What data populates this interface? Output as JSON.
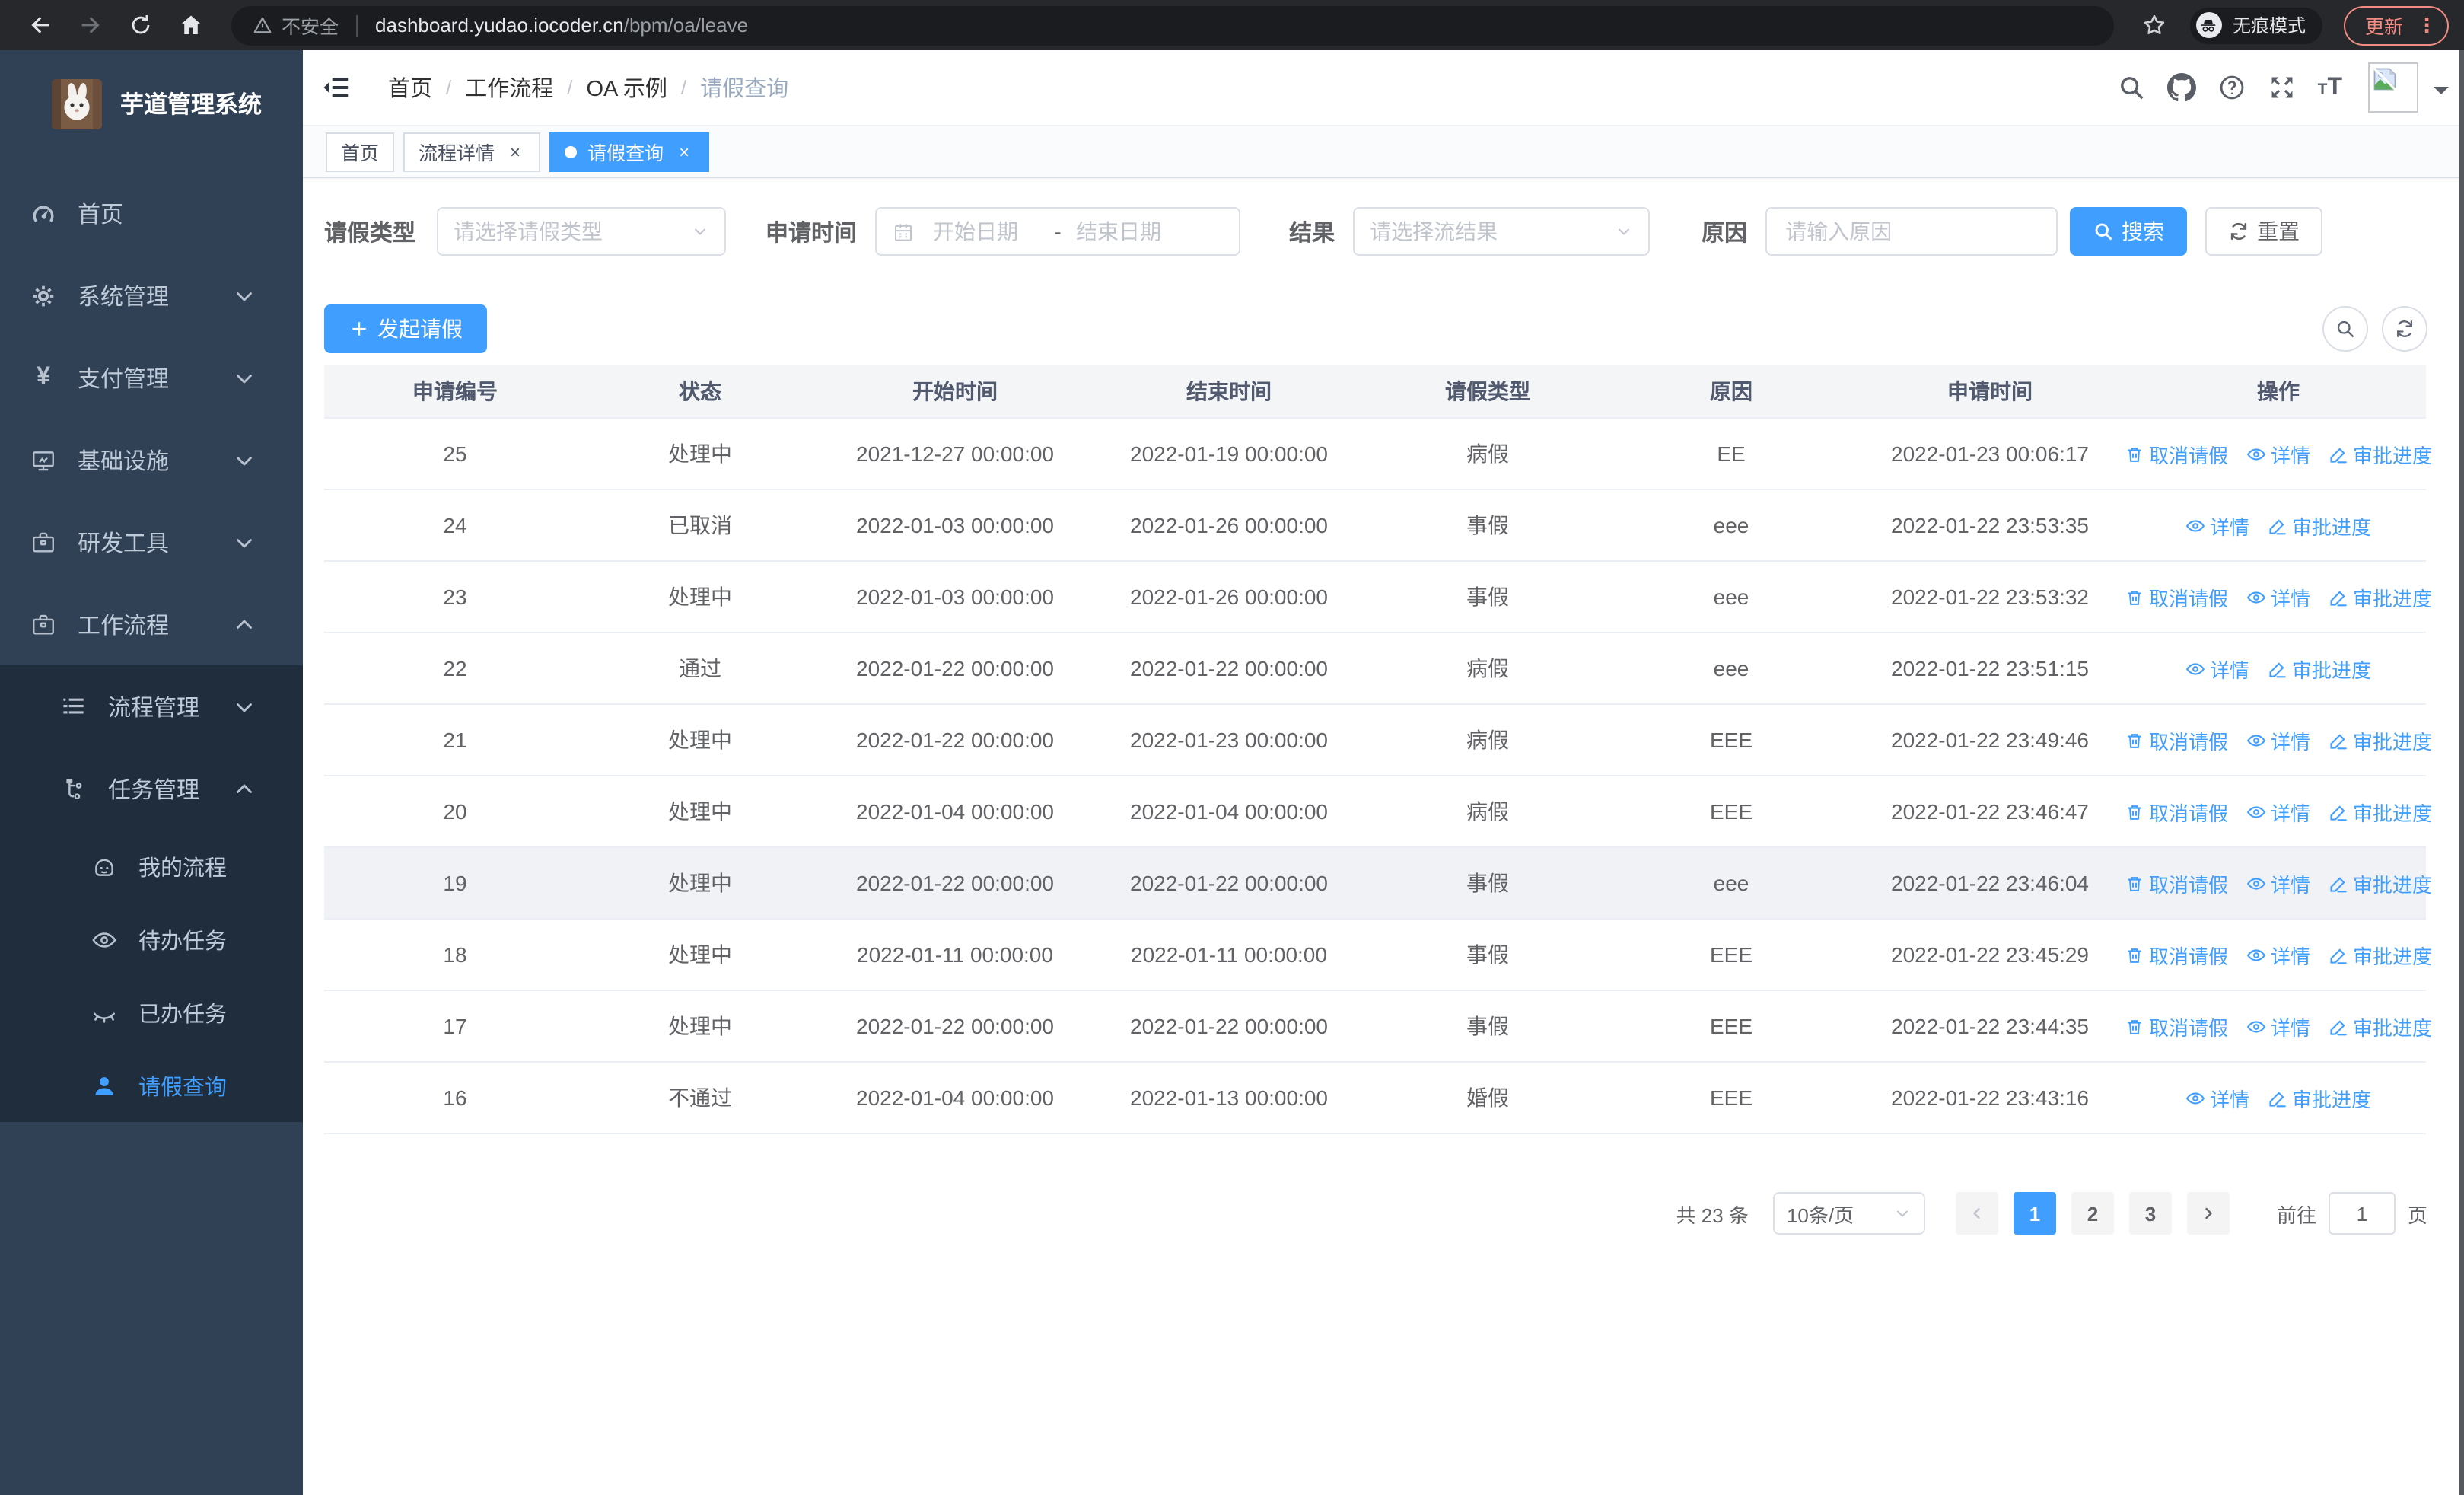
{
  "browser": {
    "security_label": "不安全",
    "url_host": "dashboard.yudao.iocoder.cn",
    "url_path": "/bpm/oa/leave",
    "incognito_label": "无痕模式",
    "update_label": "更新",
    "menu_dots": "⋮"
  },
  "sidebar": {
    "title": "芋道管理系统",
    "items": [
      {
        "label": "首页",
        "icon": "gauge"
      },
      {
        "label": "系统管理",
        "icon": "gear",
        "chevron": "down"
      },
      {
        "label": "支付管理",
        "icon": "yen",
        "chevron": "down"
      },
      {
        "label": "基础设施",
        "icon": "monitor",
        "chevron": "down"
      },
      {
        "label": "研发工具",
        "icon": "briefcase",
        "chevron": "down"
      },
      {
        "label": "工作流程",
        "icon": "briefcase",
        "chevron": "up",
        "children": [
          {
            "label": "流程管理",
            "icon": "list",
            "chevron": "down"
          },
          {
            "label": "任务管理",
            "icon": "flow",
            "chevron": "up",
            "children": [
              {
                "label": "我的流程",
                "icon": "robot"
              },
              {
                "label": "待办任务",
                "icon": "eye"
              },
              {
                "label": "已办任务",
                "icon": "eyeclosed"
              },
              {
                "label": "请假查询",
                "icon": "user",
                "active": true
              }
            ]
          }
        ]
      }
    ]
  },
  "breadcrumb": {
    "items": [
      {
        "label": "首页"
      },
      {
        "label": "工作流程"
      },
      {
        "label": "OA 示例"
      },
      {
        "label": "请假查询",
        "current": true
      }
    ],
    "separator": "/"
  },
  "tabs": [
    {
      "label": "首页",
      "closable": false,
      "active": false
    },
    {
      "label": "流程详情",
      "closable": true,
      "active": false
    },
    {
      "label": "请假查询",
      "closable": true,
      "active": true
    }
  ],
  "filters": {
    "leave_type_label": "请假类型",
    "leave_type_placeholder": "请选择请假类型",
    "apply_time_label": "申请时间",
    "start_placeholder": "开始日期",
    "separator": "-",
    "end_placeholder": "结束日期",
    "result_label": "结果",
    "result_placeholder": "请选择流结果",
    "reason_label": "原因",
    "reason_placeholder": "请输入原因",
    "search_label": "搜索",
    "reset_label": "重置"
  },
  "toolbar": {
    "create_label": "发起请假"
  },
  "table": {
    "columns": [
      "申请编号",
      "状态",
      "开始时间",
      "结束时间",
      "请假类型",
      "原因",
      "申请时间",
      "操作"
    ],
    "op_labels": {
      "cancel": "取消请假",
      "detail": "详情",
      "progress": "审批进度"
    },
    "rows": [
      {
        "id": "25",
        "status": "处理中",
        "start": "2021-12-27 00:00:00",
        "end": "2022-01-19 00:00:00",
        "type": "病假",
        "reason": "EE",
        "apply_time": "2022-01-23 00:06:17",
        "ops": [
          "cancel",
          "detail",
          "progress"
        ],
        "highlight": false
      },
      {
        "id": "24",
        "status": "已取消",
        "start": "2022-01-03 00:00:00",
        "end": "2022-01-26 00:00:00",
        "type": "事假",
        "reason": "eee",
        "apply_time": "2022-01-22 23:53:35",
        "ops": [
          "detail",
          "progress"
        ],
        "highlight": false
      },
      {
        "id": "23",
        "status": "处理中",
        "start": "2022-01-03 00:00:00",
        "end": "2022-01-26 00:00:00",
        "type": "事假",
        "reason": "eee",
        "apply_time": "2022-01-22 23:53:32",
        "ops": [
          "cancel",
          "detail",
          "progress"
        ],
        "highlight": false
      },
      {
        "id": "22",
        "status": "通过",
        "start": "2022-01-22 00:00:00",
        "end": "2022-01-22 00:00:00",
        "type": "病假",
        "reason": "eee",
        "apply_time": "2022-01-22 23:51:15",
        "ops": [
          "detail",
          "progress"
        ],
        "highlight": false
      },
      {
        "id": "21",
        "status": "处理中",
        "start": "2022-01-22 00:00:00",
        "end": "2022-01-23 00:00:00",
        "type": "病假",
        "reason": "EEE",
        "apply_time": "2022-01-22 23:49:46",
        "ops": [
          "cancel",
          "detail",
          "progress"
        ],
        "highlight": false
      },
      {
        "id": "20",
        "status": "处理中",
        "start": "2022-01-04 00:00:00",
        "end": "2022-01-04 00:00:00",
        "type": "病假",
        "reason": "EEE",
        "apply_time": "2022-01-22 23:46:47",
        "ops": [
          "cancel",
          "detail",
          "progress"
        ],
        "highlight": false
      },
      {
        "id": "19",
        "status": "处理中",
        "start": "2022-01-22 00:00:00",
        "end": "2022-01-22 00:00:00",
        "type": "事假",
        "reason": "eee",
        "apply_time": "2022-01-22 23:46:04",
        "ops": [
          "cancel",
          "detail",
          "progress"
        ],
        "highlight": true
      },
      {
        "id": "18",
        "status": "处理中",
        "start": "2022-01-11 00:00:00",
        "end": "2022-01-11 00:00:00",
        "type": "事假",
        "reason": "EEE",
        "apply_time": "2022-01-22 23:45:29",
        "ops": [
          "cancel",
          "detail",
          "progress"
        ],
        "highlight": false
      },
      {
        "id": "17",
        "status": "处理中",
        "start": "2022-01-22 00:00:00",
        "end": "2022-01-22 00:00:00",
        "type": "事假",
        "reason": "EEE",
        "apply_time": "2022-01-22 23:44:35",
        "ops": [
          "cancel",
          "detail",
          "progress"
        ],
        "highlight": false
      },
      {
        "id": "16",
        "status": "不通过",
        "start": "2022-01-04 00:00:00",
        "end": "2022-01-13 00:00:00",
        "type": "婚假",
        "reason": "EEE",
        "apply_time": "2022-01-22 23:43:16",
        "ops": [
          "detail",
          "progress"
        ],
        "highlight": false
      }
    ]
  },
  "pagination": {
    "total_label": "共 23 条",
    "page_size": "10条/页",
    "pages": [
      "1",
      "2",
      "3"
    ],
    "active_page": "1",
    "goto_label": "前往",
    "goto_value": "1",
    "page_unit": "页"
  },
  "colors": {
    "accent": "#409eff",
    "sidebar_bg": "#304156",
    "submenu_bg": "#1f2d3d",
    "update_red": "#f28b82"
  }
}
